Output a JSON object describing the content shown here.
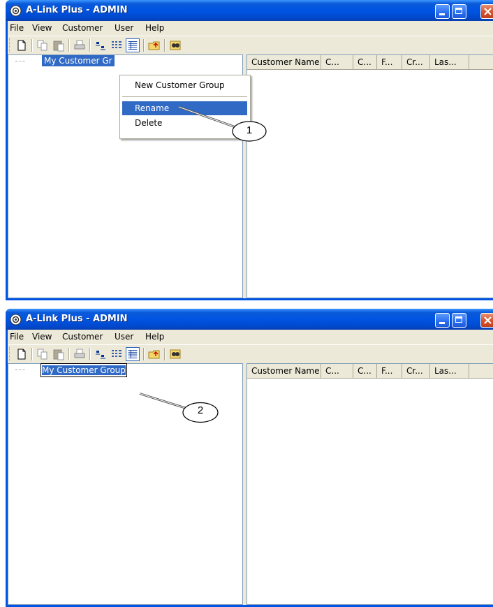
{
  "window": {
    "title": "A-Link Plus - ADMIN",
    "title_icon": "app-icon"
  },
  "menu": [
    "File",
    "View",
    "Customer",
    "User",
    "Help"
  ],
  "toolbar": {
    "icons": [
      "new-icon",
      "copy-icon",
      "paste-icon",
      "print-icon",
      "large-icons-view-icon",
      "list-view-icon",
      "details-view-icon",
      "folder-up-icon",
      "find-icon"
    ]
  },
  "tree": {
    "node_label_1": "My Customer Gr",
    "node_label_2": "My Customer Group"
  },
  "list_columns": [
    "Customer Name",
    "C...",
    "C...",
    "F...",
    "Cr...",
    "Las..."
  ],
  "context_menu": {
    "items": [
      "New Customer Group",
      "Rename",
      "Delete"
    ],
    "highlighted": "Rename"
  },
  "callouts": [
    "1",
    "2"
  ],
  "colors": {
    "titlebar": "#0054e3",
    "selection": "#316ac5",
    "face": "#ece9d8"
  }
}
